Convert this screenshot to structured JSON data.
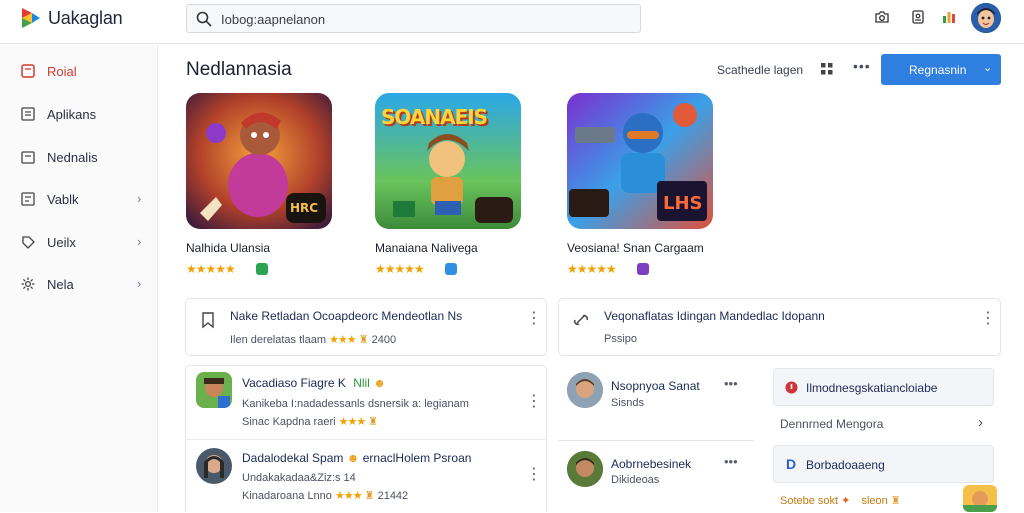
{
  "app": {
    "title": "Uakaglan"
  },
  "search": {
    "placeholder": "Iobog:aapnelanon"
  },
  "header_icons": [
    "camera-icon",
    "document-icon",
    "chart-icon",
    "user-avatar"
  ],
  "sidebar": {
    "items": [
      {
        "label": "Roial",
        "icon": "home-icon",
        "active": true,
        "chevron": false
      },
      {
        "label": "Aplikans",
        "icon": "apps-icon",
        "active": false,
        "chevron": false
      },
      {
        "label": "Nednalis",
        "icon": "news-icon",
        "active": false,
        "chevron": false
      },
      {
        "label": "Vablk",
        "icon": "list-icon",
        "active": false,
        "chevron": true
      },
      {
        "label": "Ueilx",
        "icon": "tag-icon",
        "active": false,
        "chevron": true
      },
      {
        "label": "Nela",
        "icon": "gear-icon",
        "active": false,
        "chevron": true
      }
    ]
  },
  "main": {
    "title": "Nedlannasia",
    "sort_label": "Scathedle lagen",
    "primary_button": "Regnasnin",
    "games": [
      {
        "name": "Nalhida Ulansia",
        "rating": "★★★★★",
        "badge_color": "#2aa44f",
        "art": "brawler",
        "art_text": "HRC"
      },
      {
        "name": "Manaiana Nalivega",
        "rating": "★★★★★",
        "badge_color": "#2f8fe0",
        "art": "soldiers",
        "art_text": "SOANAEIS"
      },
      {
        "name": "Veosiana! Snan Cargaam",
        "rating": "★★★★★",
        "badge_color": "#7b3fc4",
        "art": "shooter",
        "art_text": "LHS"
      }
    ],
    "panel_top_left": {
      "title": "Nake Retladan  Ocoapdeorc Mendeotlan Ns",
      "sub": "Ilen derelatas tlaam",
      "stars": "★★★",
      "count": "2400"
    },
    "panel_top_right": {
      "title": "Veqonaflatas Idingan Mandedlac Idopann",
      "sub": "Pssipo"
    },
    "list_left": [
      {
        "title": "Vacadiaso Fiagre K",
        "title_accent": "Nlil",
        "line2": "Kanikeba I:nadadessanls dsnersik a: legianam",
        "line3": "Sinac Kapdna raeri",
        "stars": "★★★",
        "extra": ""
      },
      {
        "title": "Dadalodekal Spam",
        "title_accent": "ernaclHolem Psroan",
        "line2": "Undakakadaa&Ziz:s 14",
        "line3": "Kinadaroana Lnno",
        "stars": "★★★",
        "extra": "21442"
      }
    ],
    "list_mid": [
      {
        "name": "Nsopnyoa Sanat",
        "sub": "Sisnds"
      },
      {
        "name": "Aobrnebesinek",
        "sub": "Dikideoas"
      }
    ],
    "list_right": [
      {
        "label": "Ilmodnesgskatiancloiabe",
        "icon": "alert-icon",
        "icon_color": "#d0343e"
      },
      {
        "label": "Dennrned Mengora",
        "icon": "",
        "chevron": true
      },
      {
        "label": "Borbadoaaeng",
        "icon": "d-icon",
        "icon_color": "#2a5fd3"
      },
      {
        "label": "Sotebe sokt",
        "accent": "sleon",
        "icon": "trophy-icon"
      }
    ]
  }
}
